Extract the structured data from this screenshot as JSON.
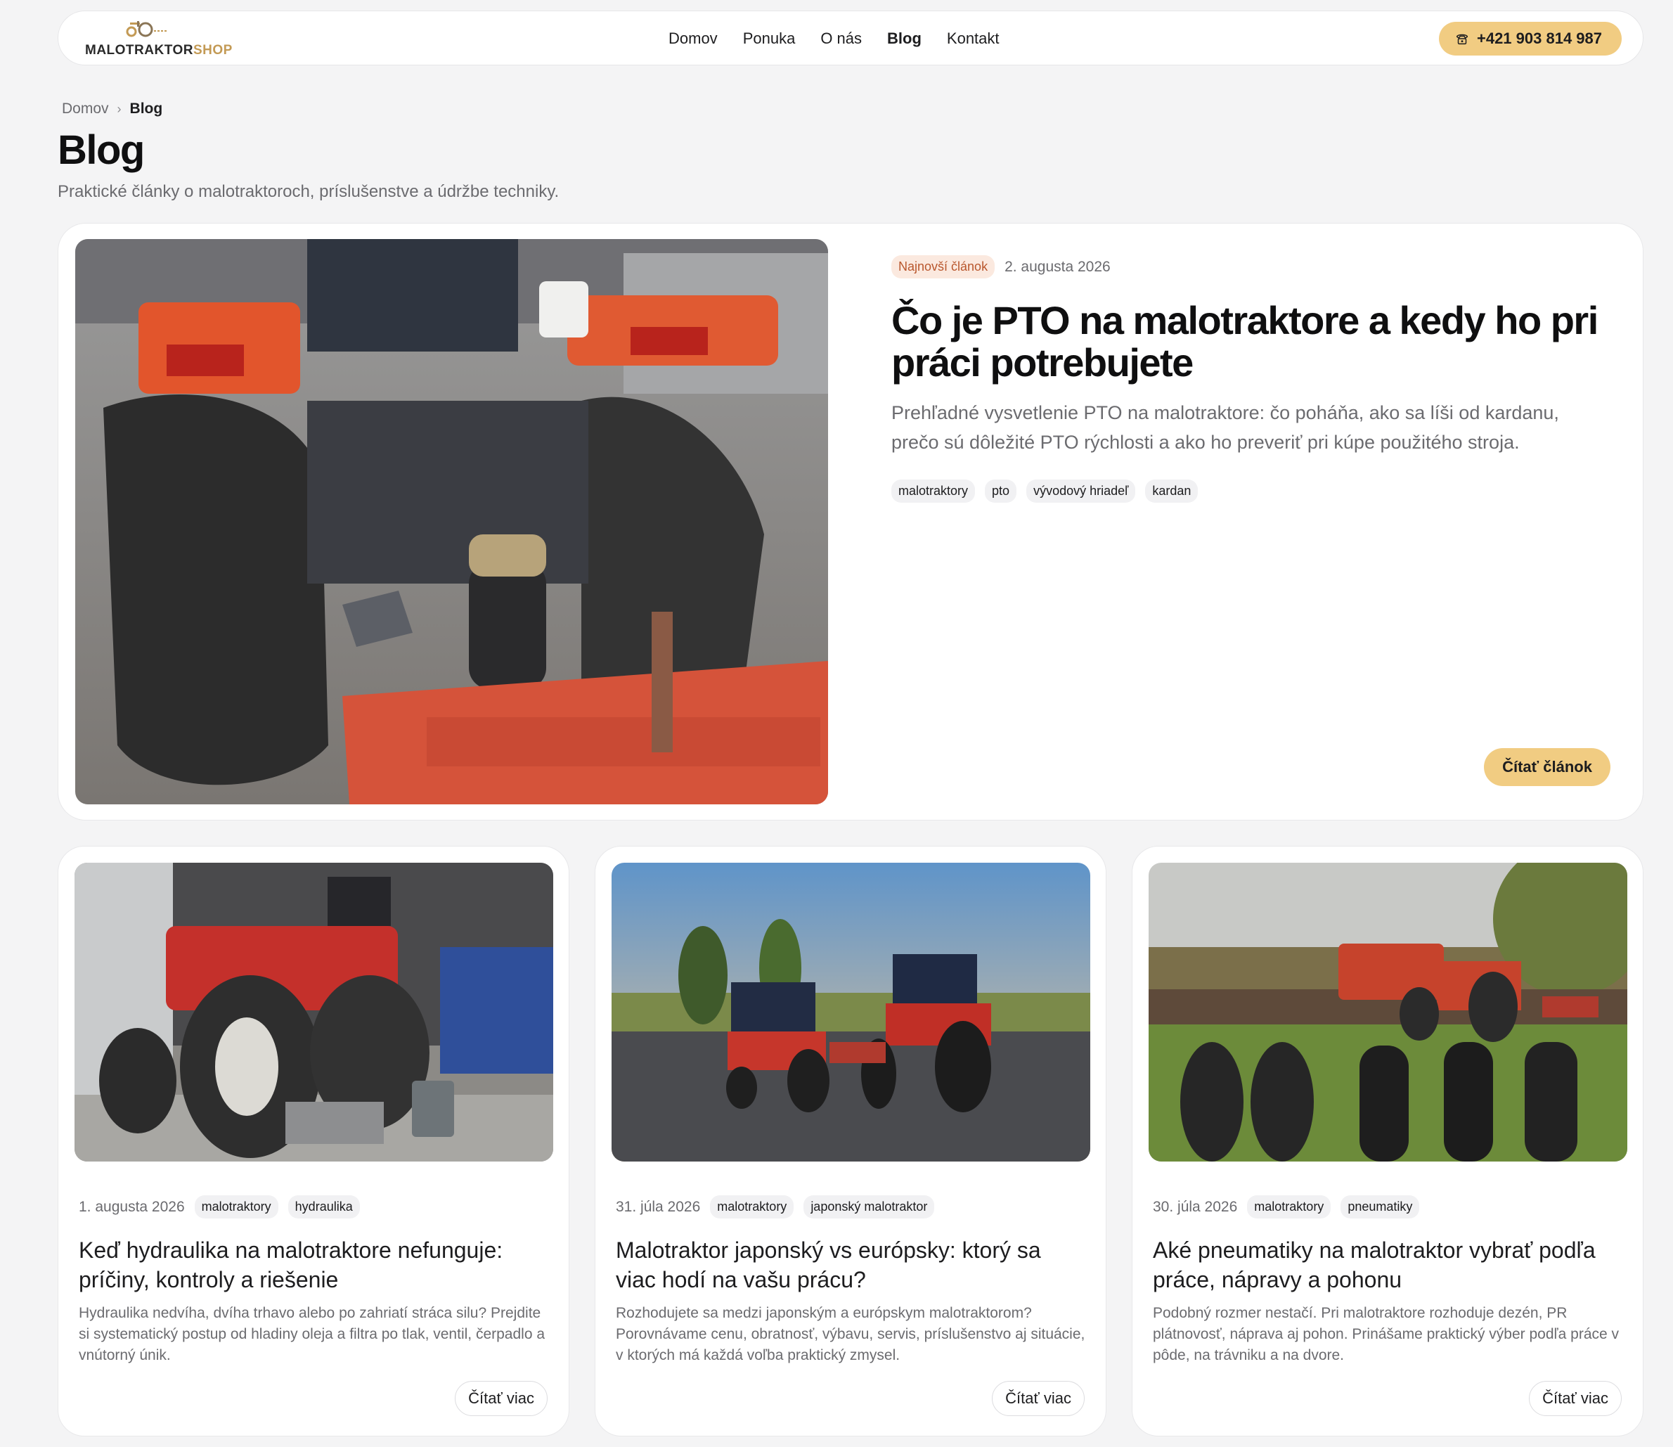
{
  "brand": {
    "name_dark": "MALOTRAKTOR",
    "name_accent": "SHOP",
    "accent_color": "#c39a55"
  },
  "nav": {
    "items": [
      {
        "label": "Domov"
      },
      {
        "label": "Ponuka"
      },
      {
        "label": "O nás"
      },
      {
        "label": "Blog",
        "active": true
      },
      {
        "label": "Kontakt"
      }
    ]
  },
  "phone": {
    "label": "+421 903 814 987",
    "icon": "phone-icon",
    "color": "#f1cc82"
  },
  "breadcrumb": {
    "home": "Domov",
    "current": "Blog"
  },
  "page": {
    "title": "Blog",
    "subtitle": "Praktické články o malotraktoroch, príslušenstve a údržbe techniky."
  },
  "featured": {
    "badge": "Najnovší článok",
    "date": "2. augusta 2026",
    "title": "Čo je PTO na malotraktore a kedy ho pri práci potrebujete",
    "excerpt": "Prehľadné vysvetlenie PTO na malotraktore: čo poháňa, ako sa líši od kardanu, prečo sú dôležité PTO rýchlosti a ako ho preveriť pri kúpe použitého stroja.",
    "tags": [
      "malotraktory",
      "pto",
      "vývodový hriadeľ",
      "kardan"
    ],
    "button": "Čítať článok"
  },
  "posts": [
    {
      "date": "1. augusta 2026",
      "tags": [
        "malotraktory",
        "hydraulika"
      ],
      "title": "Keď hydraulika na malotraktore nefunguje: príčiny, kontroly a riešenie",
      "excerpt": "Hydraulika nedvíha, dvíha trhavo alebo po zahriatí stráca silu? Prejdite si systematický postup od hladiny oleja a filtra po tlak, ventil, čerpadlo a vnútorný únik.",
      "button": "Čítať viac"
    },
    {
      "date": "31. júla 2026",
      "tags": [
        "malotraktory",
        "japonský malotraktor"
      ],
      "title": "Malotraktor japonský vs európsky: ktorý sa viac hodí na vašu prácu?",
      "excerpt": "Rozhodujete sa medzi japonským a európskym malotraktorom? Porovnávame cenu, obratnosť, výbavu, servis, príslušenstvo aj situácie, v ktorých má každá voľba praktický zmysel.",
      "button": "Čítať viac"
    },
    {
      "date": "30. júla 2026",
      "tags": [
        "malotraktory",
        "pneumatiky"
      ],
      "title": "Aké pneumatiky na malotraktor vybrať podľa práce, nápravy a pohonu",
      "excerpt": "Podobný rozmer nestačí. Pri malotraktore rozhoduje dezén, PR plátnovosť, náprava aj pohon. Prinášame praktický výber podľa práce v pôde, na trávniku a na dvore.",
      "button": "Čítať viac"
    }
  ]
}
